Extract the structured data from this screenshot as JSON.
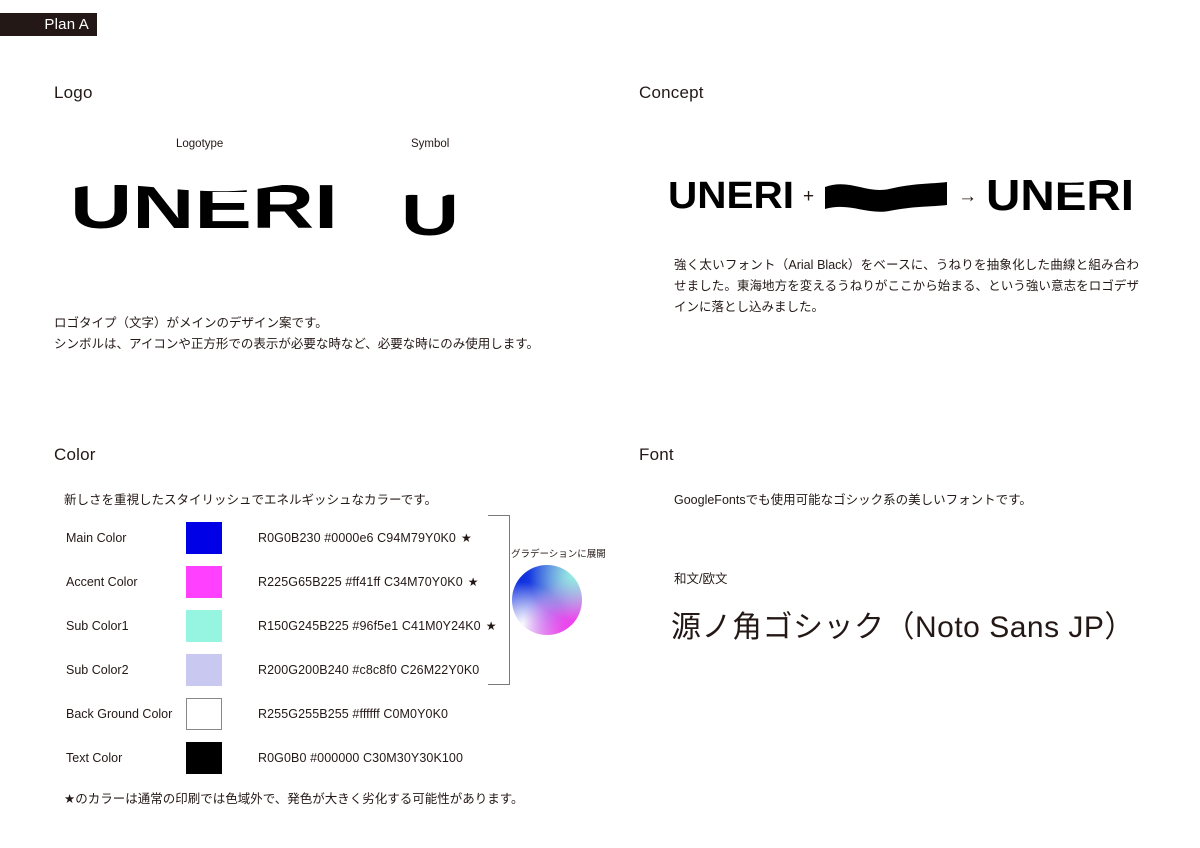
{
  "plan_badge": {
    "label": "Plan A"
  },
  "sections": {
    "logo": {
      "heading": "Logo",
      "logotype_label": "Logotype",
      "symbol_label": "Symbol",
      "logotype_text": "UNERI",
      "symbol_text": "U",
      "description_line1": "ロゴタイプ（文字）がメインのデザイン案です。",
      "description_line2": "シンボルは、アイコンや正方形での表示が必要な時など、必要な時にのみ使用します。"
    },
    "concept": {
      "heading": "Concept",
      "formula": {
        "base_word": "UNERI",
        "plus_operator": "+",
        "wave_element": "wave-bar",
        "arrow_operator": "→",
        "result_word": "UNERI"
      },
      "description": "強く太いフォント（Arial Black）をベースに、うねりを抽象化した曲線と組み合わせました。東海地方を変えるうねりがここから始まる、という強い意志をロゴデザインに落とし込みました。"
    },
    "color": {
      "heading": "Color",
      "intro": "新しさを重視したスタイリッシュでエネルギッシュなカラーです。",
      "gradient_label": "グラデーションに展開",
      "footnote": "★のカラーは通常の印刷では色域外で、発色が大きく劣化する可能性があります。",
      "rows": [
        {
          "name": "Main Color",
          "hex": "#0000e6",
          "values": "R0G0B230 #0000e6 C94M79Y0K0",
          "star": "★",
          "bordered": false
        },
        {
          "name": "Accent Color",
          "hex": "#ff41ff",
          "values": "R225G65B225 #ff41ff C34M70Y0K0",
          "star": "★",
          "bordered": false
        },
        {
          "name": "Sub Color1",
          "hex": "#96f5e1",
          "values": "R150G245B225 #96f5e1 C41M0Y24K0",
          "star": "★",
          "bordered": false
        },
        {
          "name": "Sub Color2",
          "hex": "#c8c8f0",
          "values": "R200G200B240 #c8c8f0 C26M22Y0K0",
          "star": "",
          "bordered": false
        },
        {
          "name": "Back Ground Color",
          "hex": "#ffffff",
          "values": "R255G255B255 #ffffff C0M0Y0K0",
          "star": "",
          "bordered": true
        },
        {
          "name": "Text Color",
          "hex": "#000000",
          "values": "R0G0B0 #000000 C30M30Y30K100",
          "star": "",
          "bordered": false
        }
      ]
    },
    "font": {
      "heading": "Font",
      "intro": "GoogleFontsでも使用可能なゴシック系の美しいフォントです。",
      "subtitle": "和文/欧文",
      "sample": "源ノ角ゴシック（Noto Sans JP）"
    }
  }
}
